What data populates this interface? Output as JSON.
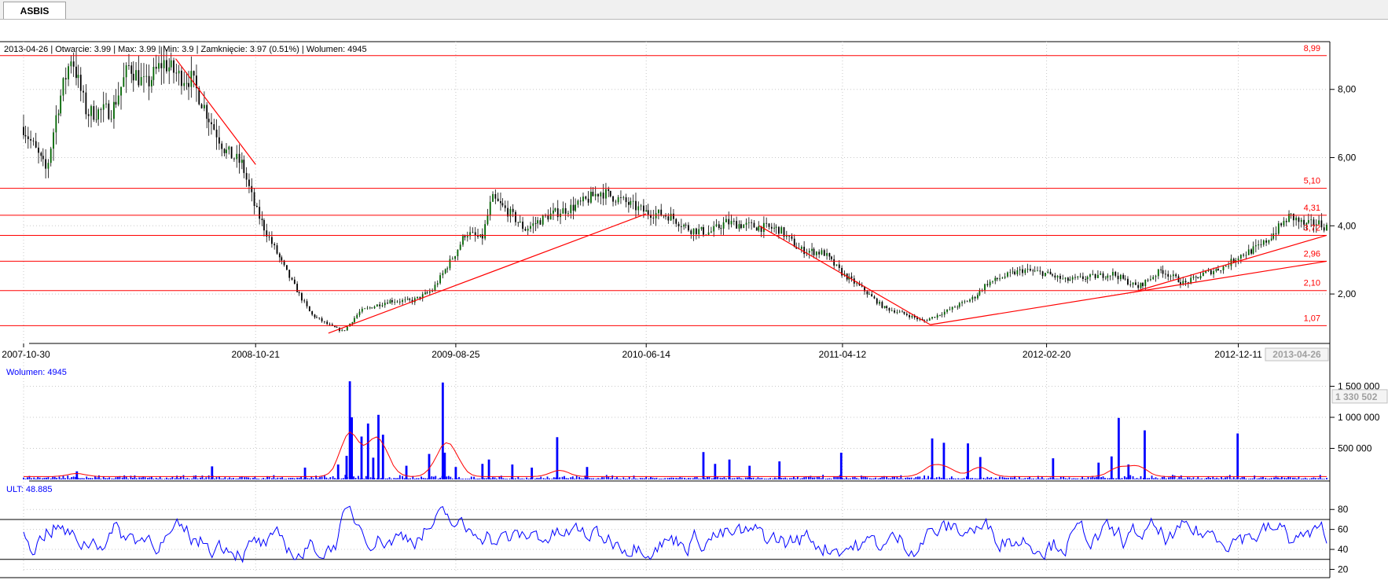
{
  "tab": {
    "label": "ASBIS"
  },
  "colors": {
    "price_candle": "#006400",
    "level_line": "#ff0000",
    "level_label": "#ff0000",
    "volume_bar": "#0000ff",
    "volume_ma": "#ff0000",
    "oscillator": "#0000ff",
    "grid": "#c8c8c8",
    "axis": "#000000",
    "info_blue": "#0000ff"
  },
  "chart_data": [
    {
      "type": "candlestick",
      "header": "2013-04-26 | Otwarcie: 3.99 | Max: 3.99 | Min: 3.9 | Zamknięcie: 3.97 (0.51%)   | Wolumen: 4945",
      "x_tick_labels": [
        "2007-10-30",
        "2008-10-21",
        "2009-08-25",
        "2010-06-14",
        "2011-04-12",
        "2012-02-20",
        "2012-12-11"
      ],
      "x_current_label": "2013-04-26",
      "x_range": [
        "2007-10-30",
        "2013-04-26"
      ],
      "y_tick_labels": [
        "2,00",
        "4,00",
        "6,00",
        "8,00"
      ],
      "y_ticks": [
        2,
        4,
        6,
        8
      ],
      "ylim": [
        0.55,
        9.4
      ],
      "grid": true,
      "close_path": [
        [
          "2007-10-30",
          6.9
        ],
        [
          "2007-12-05",
          5.6
        ],
        [
          "2007-12-20",
          7.3
        ],
        [
          "2008-01-12",
          9.0
        ],
        [
          "2008-02-05",
          7.3
        ],
        [
          "2008-03-15",
          7.4
        ],
        [
          "2008-04-10",
          8.7
        ],
        [
          "2008-05-05",
          8.1
        ],
        [
          "2008-06-01",
          8.8
        ],
        [
          "2008-06-25",
          8.4
        ],
        [
          "2008-07-15",
          8.3
        ],
        [
          "2008-08-10",
          7.2
        ],
        [
          "2008-09-05",
          6.2
        ],
        [
          "2008-10-01",
          5.8
        ],
        [
          "2008-10-21",
          4.5
        ],
        [
          "2008-11-15",
          3.5
        ],
        [
          "2008-12-15",
          2.4
        ],
        [
          "2009-01-15",
          1.4
        ],
        [
          "2009-02-10",
          1.1
        ],
        [
          "2009-03-05",
          0.9
        ],
        [
          "2009-04-01",
          1.5
        ],
        [
          "2009-05-15",
          1.8
        ],
        [
          "2009-06-20",
          1.8
        ],
        [
          "2009-07-20",
          2.1
        ],
        [
          "2009-08-25",
          3.2
        ],
        [
          "2009-09-10",
          3.8
        ],
        [
          "2009-10-05",
          3.6
        ],
        [
          "2009-10-20",
          4.8
        ],
        [
          "2009-11-15",
          4.4
        ],
        [
          "2009-12-10",
          3.9
        ],
        [
          "2010-01-15",
          4.3
        ],
        [
          "2010-03-01",
          4.6
        ],
        [
          "2010-04-05",
          5.0
        ],
        [
          "2010-05-01",
          4.8
        ],
        [
          "2010-06-14",
          4.4
        ],
        [
          "2010-07-20",
          4.3
        ],
        [
          "2010-08-20",
          3.9
        ],
        [
          "2010-09-20",
          3.8
        ],
        [
          "2010-10-15",
          4.1
        ],
        [
          "2010-11-20",
          4.0
        ],
        [
          "2011-01-05",
          3.9
        ],
        [
          "2011-02-05",
          3.3
        ],
        [
          "2011-03-15",
          3.2
        ],
        [
          "2011-04-12",
          2.6
        ],
        [
          "2011-05-10",
          2.2
        ],
        [
          "2011-06-15",
          1.6
        ],
        [
          "2011-07-20",
          1.4
        ],
        [
          "2011-08-15",
          1.2
        ],
        [
          "2011-09-20",
          1.5
        ],
        [
          "2011-11-01",
          1.9
        ],
        [
          "2011-11-20",
          2.3
        ],
        [
          "2011-12-15",
          2.5
        ],
        [
          "2012-01-15",
          2.7
        ],
        [
          "2012-02-20",
          2.6
        ],
        [
          "2012-03-20",
          2.4
        ],
        [
          "2012-05-01",
          2.5
        ],
        [
          "2012-06-01",
          2.6
        ],
        [
          "2012-07-10",
          2.2
        ],
        [
          "2012-08-15",
          2.7
        ],
        [
          "2012-09-20",
          2.3
        ],
        [
          "2012-10-20",
          2.6
        ],
        [
          "2012-11-20",
          2.8
        ],
        [
          "2012-12-11",
          3.1
        ],
        [
          "2013-01-15",
          3.4
        ],
        [
          "2013-02-05",
          3.8
        ],
        [
          "2013-03-01",
          4.3
        ],
        [
          "2013-03-25",
          4.0
        ],
        [
          "2013-04-10",
          4.1
        ],
        [
          "2013-04-26",
          3.97
        ]
      ],
      "horizontal_levels": [
        {
          "value": 8.99,
          "label": "8,99"
        },
        {
          "value": 5.1,
          "label": "5,10"
        },
        {
          "value": 4.31,
          "label": "4,31"
        },
        {
          "value": 3.72,
          "label": "3,72"
        },
        {
          "value": 2.96,
          "label": "2,96"
        },
        {
          "value": 2.1,
          "label": "2,10"
        },
        {
          "value": 1.07,
          "label": "1,07"
        }
      ],
      "trend_lines": [
        {
          "from": [
            "2008-06-20",
            8.9
          ],
          "to": [
            "2008-10-21",
            5.8
          ]
        },
        {
          "from": [
            "2009-02-10",
            0.85
          ],
          "to": [
            "2010-06-14",
            4.35
          ]
        },
        {
          "from": [
            "2010-12-05",
            4.0
          ],
          "to": [
            "2011-08-25",
            1.1
          ]
        },
        {
          "from": [
            "2011-08-25",
            1.1
          ],
          "to": [
            "2013-04-26",
            2.96
          ]
        },
        {
          "from": [
            "2012-07-10",
            2.1
          ],
          "to": [
            "2013-04-26",
            3.72
          ]
        }
      ]
    },
    {
      "type": "bar",
      "title": "Wolumen: 4945",
      "y_tick_labels": [
        "500 000",
        "1 000 000",
        "1 500 000"
      ],
      "y_ticks": [
        500000,
        1000000,
        1500000
      ],
      "ylim": [
        0,
        1620000
      ],
      "current_value_label": "1 330 502",
      "current_value": 1330502,
      "x_range": [
        "2007-10-30",
        "2013-04-26"
      ],
      "spikes": [
        [
          "2008-01-20",
          130000
        ],
        [
          "2008-08-15",
          210000
        ],
        [
          "2009-01-05",
          190000
        ],
        [
          "2009-02-25",
          240000
        ],
        [
          "2009-03-10",
          380000
        ],
        [
          "2009-03-15",
          1580000
        ],
        [
          "2009-03-18",
          1000000
        ],
        [
          "2009-04-02",
          690000
        ],
        [
          "2009-04-12",
          900000
        ],
        [
          "2009-04-20",
          350000
        ],
        [
          "2009-04-28",
          1040000
        ],
        [
          "2009-05-05",
          720000
        ],
        [
          "2009-06-10",
          220000
        ],
        [
          "2009-07-15",
          410000
        ],
        [
          "2009-08-05",
          1560000
        ],
        [
          "2009-08-08",
          430000
        ],
        [
          "2009-08-25",
          200000
        ],
        [
          "2009-10-05",
          250000
        ],
        [
          "2009-10-15",
          320000
        ],
        [
          "2009-11-20",
          240000
        ],
        [
          "2009-12-20",
          190000
        ],
        [
          "2010-01-28",
          680000
        ],
        [
          "2010-03-15",
          200000
        ],
        [
          "2010-09-10",
          440000
        ],
        [
          "2010-09-28",
          250000
        ],
        [
          "2010-10-20",
          320000
        ],
        [
          "2010-11-20",
          220000
        ],
        [
          "2011-01-05",
          290000
        ],
        [
          "2011-04-10",
          430000
        ],
        [
          "2011-08-28",
          660000
        ],
        [
          "2011-09-15",
          590000
        ],
        [
          "2011-10-22",
          580000
        ],
        [
          "2011-11-10",
          360000
        ],
        [
          "2012-03-01",
          340000
        ],
        [
          "2012-05-10",
          270000
        ],
        [
          "2012-05-30",
          370000
        ],
        [
          "2012-06-10",
          990000
        ],
        [
          "2012-06-25",
          240000
        ],
        [
          "2012-07-20",
          790000
        ],
        [
          "2012-12-10",
          740000
        ]
      ],
      "ma_bumps": [
        [
          "2008-01-20",
          50000
        ],
        [
          "2009-03-15",
          700000
        ],
        [
          "2009-04-20",
          420000
        ],
        [
          "2009-05-05",
          300000
        ],
        [
          "2009-08-05",
          330000
        ],
        [
          "2009-08-20",
          300000
        ],
        [
          "2010-02-01",
          100000
        ],
        [
          "2011-08-28",
          150000
        ],
        [
          "2011-09-20",
          120000
        ],
        [
          "2011-11-10",
          150000
        ],
        [
          "2012-06-10",
          140000
        ],
        [
          "2012-07-10",
          160000
        ]
      ]
    },
    {
      "type": "line",
      "title": "ULT: 48.885",
      "y_tick_labels": [
        "20",
        "40",
        "60",
        "80"
      ],
      "y_ticks": [
        20,
        40,
        60,
        80
      ],
      "ylim": [
        18,
        92
      ],
      "reference_lines": [
        70,
        30
      ],
      "x_range": [
        "2007-10-30",
        "2013-04-26"
      ]
    }
  ]
}
